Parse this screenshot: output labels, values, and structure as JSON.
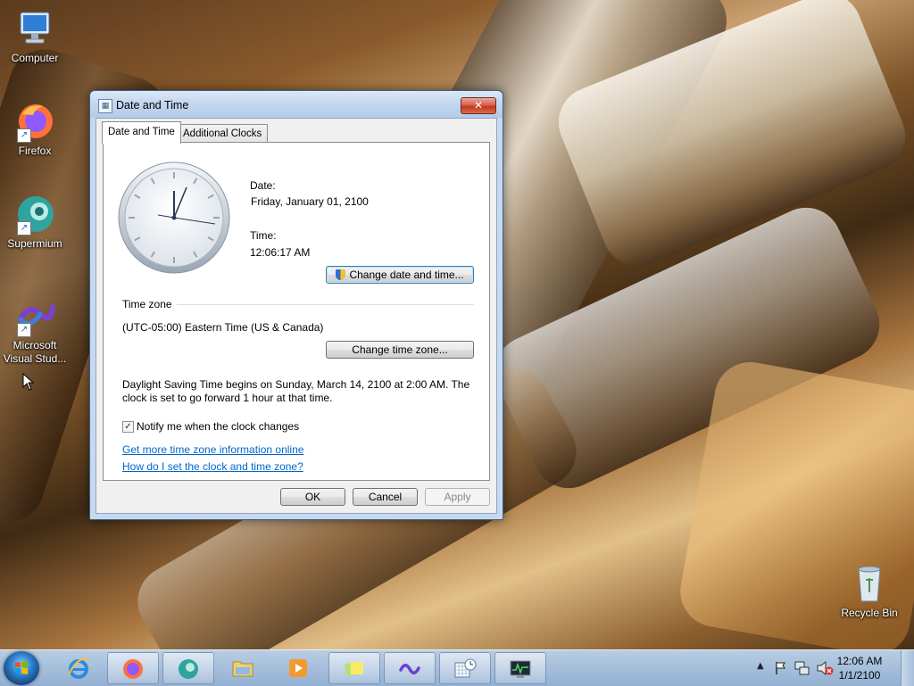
{
  "desktop": {
    "icons": [
      {
        "label": "Computer"
      },
      {
        "label": "Firefox"
      },
      {
        "label": "Supermium"
      },
      {
        "label": "Microsoft Visual Stud..."
      },
      {
        "label": "Recycle Bin"
      }
    ]
  },
  "dialog": {
    "title": "Date and Time",
    "close_glyph": "✕",
    "tabs": [
      {
        "label": "Date and Time",
        "active": true
      },
      {
        "label": "Additional Clocks",
        "active": false
      }
    ],
    "date_label": "Date:",
    "date_value": "Friday, January 01, 2100",
    "time_label": "Time:",
    "time_value": "12:06:17 AM",
    "change_datetime_button": "Change date and time...",
    "timezone_heading": "Time zone",
    "timezone_value": "(UTC-05:00) Eastern Time (US & Canada)",
    "change_timezone_button": "Change time zone...",
    "dst_line1": "Daylight Saving Time begins on Sunday, March 14, 2100 at 2:00 AM. The",
    "dst_line2": "clock is set to go forward 1 hour at that time.",
    "notify_checkbox_label": "Notify me when the clock changes",
    "notify_checked": true,
    "link_more_info": "Get more time zone information online",
    "link_how_set": "How do I set the clock and time zone?",
    "ok_button": "OK",
    "cancel_button": "Cancel",
    "apply_button": "Apply"
  },
  "taskbar": {
    "clock_time": "12:06 AM",
    "clock_date": "1/1/2100",
    "pinned": [
      "Internet Explorer",
      "Firefox",
      "Supermium",
      "File Explorer",
      "Media Player",
      "Sticky Notes",
      "Visual Studio",
      "Date and Time",
      "System Monitor"
    ]
  },
  "colors": {
    "link": "#0066cc",
    "close_button": "#c4391f",
    "taskbar": "#a7c0dc"
  }
}
